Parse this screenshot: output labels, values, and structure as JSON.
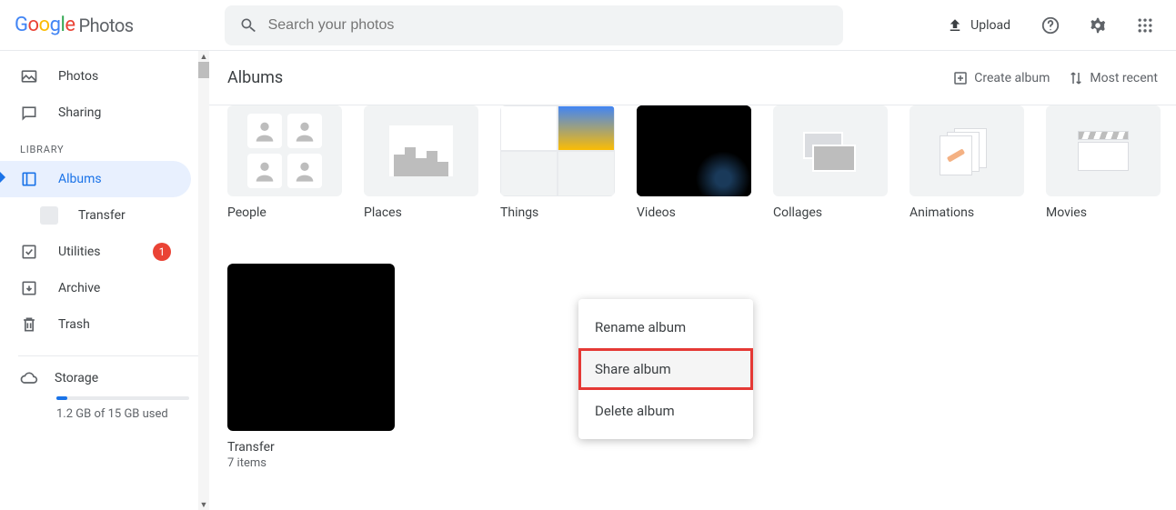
{
  "header": {
    "logo_text": "Photos",
    "search_placeholder": "Search your photos",
    "upload_label": "Upload"
  },
  "sidebar": {
    "photos_label": "Photos",
    "sharing_label": "Sharing",
    "library_section": "LIBRARY",
    "albums_label": "Albums",
    "transfer_label": "Transfer",
    "utilities_label": "Utilities",
    "utilities_badge": "1",
    "archive_label": "Archive",
    "trash_label": "Trash",
    "storage_label": "Storage",
    "storage_text": "1.2 GB of 15 GB used"
  },
  "page": {
    "title": "Albums",
    "create_label": "Create album",
    "sort_label": "Most recent"
  },
  "categories": [
    {
      "label": "People"
    },
    {
      "label": "Places"
    },
    {
      "label": "Things"
    },
    {
      "label": "Videos"
    },
    {
      "label": "Collages"
    },
    {
      "label": "Animations"
    },
    {
      "label": "Movies"
    }
  ],
  "user_albums": [
    {
      "title": "Transfer",
      "meta": "7 items"
    }
  ],
  "context_menu": {
    "rename": "Rename album",
    "share": "Share album",
    "delete": "Delete album"
  }
}
